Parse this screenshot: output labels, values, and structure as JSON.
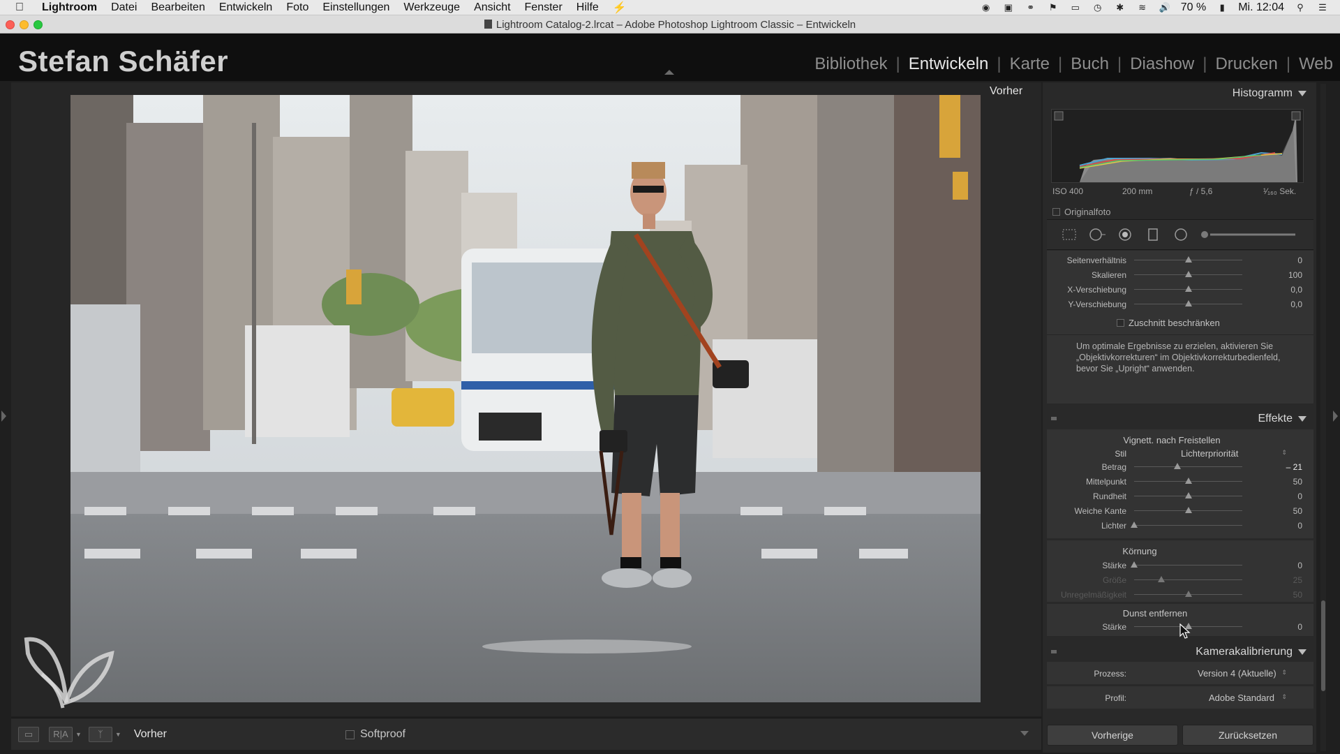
{
  "menubar": {
    "app": "Lightroom",
    "items": [
      "Datei",
      "Bearbeiten",
      "Entwickeln",
      "Foto",
      "Einstellungen",
      "Werkzeuge",
      "Ansicht",
      "Fenster",
      "Hilfe"
    ],
    "battery": "70 %",
    "clock": "Mi. 12:04"
  },
  "window": {
    "title": "Lightroom Catalog-2.lrcat – Adobe Photoshop Lightroom Classic – Entwickeln"
  },
  "header": {
    "identity": "Stefan Schäfer",
    "modules": [
      {
        "label": "Bibliothek",
        "active": false
      },
      {
        "label": "Entwickeln",
        "active": true
      },
      {
        "label": "Karte",
        "active": false
      },
      {
        "label": "Buch",
        "active": false
      },
      {
        "label": "Diashow",
        "active": false
      },
      {
        "label": "Drucken",
        "active": false
      },
      {
        "label": "Web",
        "active": false
      }
    ]
  },
  "view": {
    "label": "Vorher"
  },
  "toolbar": {
    "view_label": "Vorher",
    "softproof_label": "Softproof",
    "compare_label": "R|A"
  },
  "histogram": {
    "title": "Histogramm",
    "iso": "ISO 400",
    "focal": "200 mm",
    "aperture": "ƒ / 5,6",
    "shutter": "¹⁄₁₆₀ Sek.",
    "original_label": "Originalfoto"
  },
  "transform": {
    "rows": [
      {
        "label": "Seitenverhältnis",
        "value": "0",
        "pos": 0.5
      },
      {
        "label": "Skalieren",
        "value": "100",
        "pos": 0.5
      },
      {
        "label": "X-Verschiebung",
        "value": "0,0",
        "pos": 0.5
      },
      {
        "label": "Y-Verschiebung",
        "value": "0,0",
        "pos": 0.5
      }
    ],
    "constrain_label": "Zuschnitt beschränken",
    "hint": "Um optimale Ergebnisse zu erzielen, aktivieren Sie „Objektivkorrekturen“ im Objektivkorrekturbedienfeld, bevor Sie „Upright“ anwenden."
  },
  "effects": {
    "title": "Effekte",
    "vignette_title": "Vignett. nach Freistellen",
    "style_label": "Stil",
    "style_value": "Lichterpriorität",
    "vignette_rows": [
      {
        "label": "Betrag",
        "value": "– 21",
        "pos": 0.4
      },
      {
        "label": "Mittelpunkt",
        "value": "50",
        "pos": 0.5
      },
      {
        "label": "Rundheit",
        "value": "0",
        "pos": 0.5
      },
      {
        "label": "Weiche Kante",
        "value": "50",
        "pos": 0.5
      },
      {
        "label": "Lichter",
        "value": "0",
        "pos": 0.0
      }
    ],
    "grain_title": "Körnung",
    "grain_rows": [
      {
        "label": "Stärke",
        "value": "0",
        "pos": 0.0,
        "dim": false
      },
      {
        "label": "Größe",
        "value": "25",
        "pos": 0.25,
        "dim": true
      },
      {
        "label": "Unregelmäßigkeit",
        "value": "50",
        "pos": 0.5,
        "dim": true
      }
    ],
    "dehaze_title": "Dunst entfernen",
    "dehaze_rows": [
      {
        "label": "Stärke",
        "value": "0",
        "pos": 0.5
      }
    ]
  },
  "calibration": {
    "title": "Kamerakalibrierung",
    "process_label": "Prozess:",
    "process_value": "Version 4 (Aktuelle)",
    "profile_label": "Profil:",
    "profile_value": "Adobe Standard"
  },
  "buttons": {
    "previous": "Vorherige",
    "reset": "Zurücksetzen"
  },
  "colors": {
    "panel_bg": "#333333",
    "app_bg": "#1f1f1f",
    "active_module": "#e8e8e8",
    "inactive_module": "#8e8e8e"
  }
}
